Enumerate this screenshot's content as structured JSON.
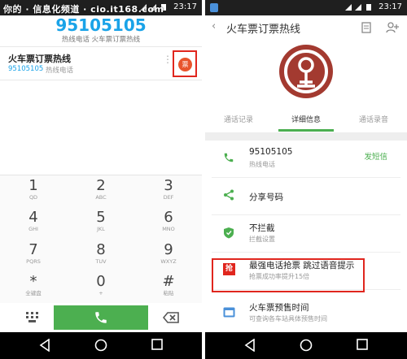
{
  "watermark": "你的 · 信息化频道 · cio.it168.com",
  "left": {
    "status": {
      "time": "23:17"
    },
    "dialed_number": "95105105",
    "dialed_sub": "热线电话 火车票订票热线",
    "suggestion": {
      "name": "火车票订票热线",
      "number": "95105105",
      "type": "热线电话",
      "badge": "票",
      "more": "⋮"
    },
    "keys": [
      {
        "digit": "1",
        "letters": "QD"
      },
      {
        "digit": "2",
        "letters": "ABC"
      },
      {
        "digit": "3",
        "letters": "DEF"
      },
      {
        "digit": "4",
        "letters": "GHI"
      },
      {
        "digit": "5",
        "letters": "JKL"
      },
      {
        "digit": "6",
        "letters": "MNO"
      },
      {
        "digit": "7",
        "letters": "PQRS"
      },
      {
        "digit": "8",
        "letters": "TUV"
      },
      {
        "digit": "9",
        "letters": "WXYZ"
      },
      {
        "digit": "*",
        "letters": "全键盘"
      },
      {
        "digit": "0",
        "letters": "+"
      },
      {
        "digit": "#",
        "letters": "粘贴"
      }
    ]
  },
  "right": {
    "status": {
      "time": "23:17"
    },
    "title": "火车票订票热线",
    "back": "‹",
    "tabs": [
      {
        "label": "通话记录"
      },
      {
        "label": "详细信息"
      },
      {
        "label": "通话录音"
      }
    ],
    "rows": [
      {
        "title": "95105105",
        "subtitle": "热线电话",
        "action": "发短信"
      },
      {
        "title": "分享号码"
      },
      {
        "title": "不拦截",
        "subtitle": "拦截设置"
      },
      {
        "title": "最强电话抢票 跳过语音提示",
        "subtitle": "抢票成功率提升15倍"
      },
      {
        "title": "火车票预售时间",
        "subtitle": "可查询各车站具体预售时间"
      }
    ]
  },
  "colors": {
    "accent_blue": "#1aa3e8",
    "green": "#4caf50",
    "red": "#e0261e",
    "logo": "#a33a30"
  }
}
